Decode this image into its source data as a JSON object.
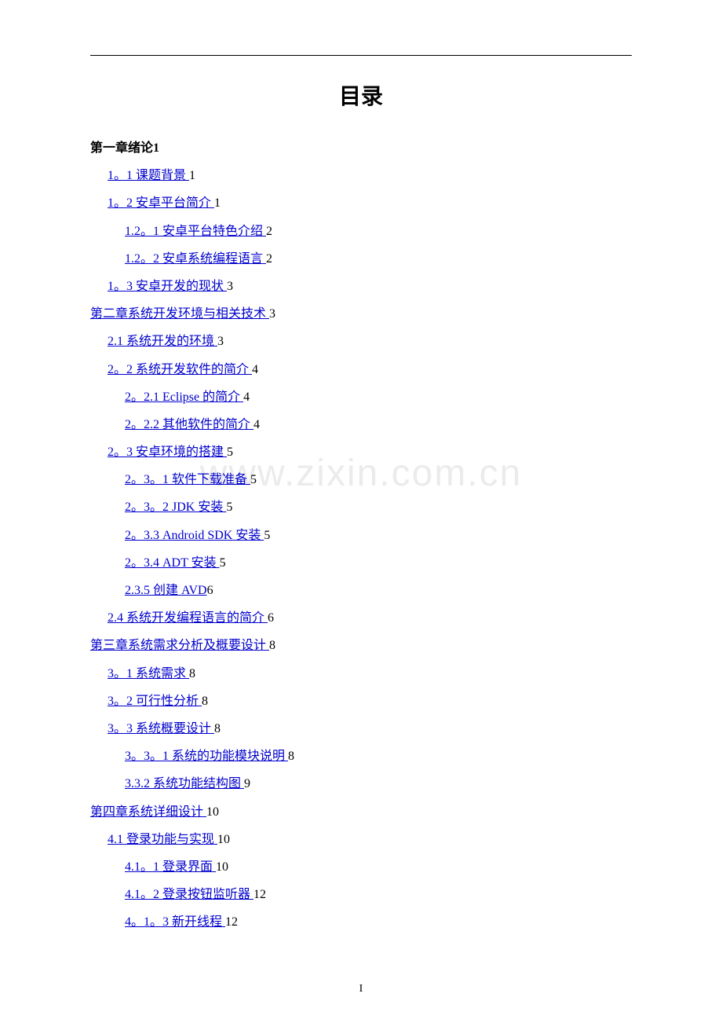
{
  "title": "目录",
  "watermark": "www.zixin.com.cn",
  "pageNumber": "I",
  "toc": [
    {
      "level": 0,
      "link": false,
      "bold": true,
      "text": "第一章绪论",
      "page": "1"
    },
    {
      "level": 1,
      "link": true,
      "text": "1。1 课题背景 ",
      "page": "1"
    },
    {
      "level": 1,
      "link": true,
      "text": "1。2 安卓平台简介 ",
      "page": "1"
    },
    {
      "level": 2,
      "link": true,
      "text": "1.2。1 安卓平台特色介绍 ",
      "page": "2"
    },
    {
      "level": 2,
      "link": true,
      "text": "1.2。2 安卓系统编程语言 ",
      "page": "2"
    },
    {
      "level": 1,
      "link": true,
      "text": "1。3 安卓开发的现状 ",
      "page": "3"
    },
    {
      "level": 0,
      "link": true,
      "text": "第二章系统开发环境与相关技术 ",
      "page": "3"
    },
    {
      "level": 1,
      "link": true,
      "text": "2.1 系统开发的环境 ",
      "page": "3"
    },
    {
      "level": 1,
      "link": true,
      "text": "2。2 系统开发软件的简介 ",
      "page": "4"
    },
    {
      "level": 2,
      "link": true,
      "text": "2。2.1 Eclipse 的简介 ",
      "page": "4"
    },
    {
      "level": 2,
      "link": true,
      "text": "2。2.2 其他软件的简介 ",
      "page": "4"
    },
    {
      "level": 1,
      "link": true,
      "text": "2。3 安卓环境的搭建 ",
      "page": "5"
    },
    {
      "level": 2,
      "link": true,
      "text": "2。3。1 软件下载准备 ",
      "page": "5"
    },
    {
      "level": 2,
      "link": true,
      "text": "2。3。2 JDK 安装 ",
      "page": "5"
    },
    {
      "level": 2,
      "link": true,
      "text": "2。3.3 Android SDK 安装 ",
      "page": "5"
    },
    {
      "level": 2,
      "link": true,
      "text": "2。3.4 ADT 安装 ",
      "page": "5"
    },
    {
      "level": 2,
      "link": true,
      "text": "2.3.5 创建 AVD",
      "page": "6"
    },
    {
      "level": 1,
      "link": true,
      "text": "2.4 系统开发编程语言的简介 ",
      "page": "6"
    },
    {
      "level": 0,
      "link": true,
      "text": "第三章系统需求分析及概要设计 ",
      "page": "8"
    },
    {
      "level": 1,
      "link": true,
      "text": "3。1 系统需求 ",
      "page": "8"
    },
    {
      "level": 1,
      "link": true,
      "text": "3。2 可行性分析 ",
      "page": "8"
    },
    {
      "level": 1,
      "link": true,
      "text": "3。3 系统概要设计 ",
      "page": "8"
    },
    {
      "level": 2,
      "link": true,
      "text": "3。3。1 系统的功能模块说明 ",
      "page": "8"
    },
    {
      "level": 2,
      "link": true,
      "text": "3.3.2 系统功能结构图 ",
      "page": "9"
    },
    {
      "level": 0,
      "link": true,
      "text": "第四章系统详细设计 ",
      "page": "10"
    },
    {
      "level": 1,
      "link": true,
      "text": "4.1 登录功能与实现 ",
      "page": "10"
    },
    {
      "level": 2,
      "link": true,
      "text": "4.1。1 登录界面 ",
      "page": "10"
    },
    {
      "level": 2,
      "link": true,
      "text": "4.1。2 登录按钮监听器 ",
      "page": "12"
    },
    {
      "level": 2,
      "link": true,
      "text": "4。1。3 新开线程 ",
      "page": "12"
    }
  ]
}
